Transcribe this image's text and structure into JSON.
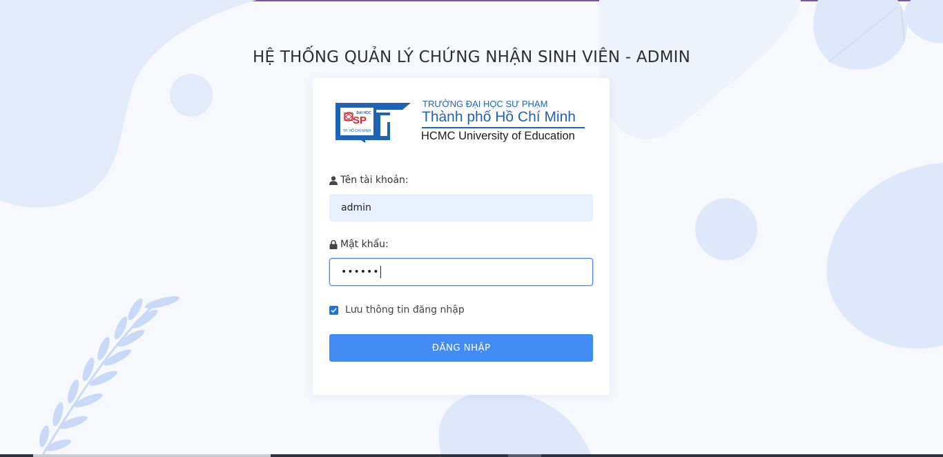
{
  "page": {
    "title": "HỆ THỐNG QUẢN LÝ CHỨNG NHẬN SINH VIÊN - ADMIN"
  },
  "logo": {
    "emblem_top_text": "ĐẠI HỌC",
    "emblem_main_text": "SP",
    "emblem_bottom_text": "TP. HỒ CHÍ MINH",
    "line1": "TRƯỜNG ĐẠI HỌC SƯ PHẠM",
    "line2": "Thành phố Hồ Chí Minh",
    "line3": "HCMC University of Education"
  },
  "form": {
    "username_label": "Tên tài khoản:",
    "username_value": "admin",
    "password_label": "Mật khẩu:",
    "password_masked": "••••••",
    "remember_label": "Lưu thông tin đăng nhập",
    "remember_checked": true,
    "submit_label": "ĐĂNG NHẬP"
  },
  "icons": {
    "username": "user-icon",
    "password": "lock-icon",
    "remember": "check-icon"
  },
  "colors": {
    "accent": "#428bf2",
    "logo_blue": "#1e63b5",
    "input_fill": "#e8effd",
    "background": "#f6f8fc",
    "decor": "#dfe8fb",
    "top_border": "#7b52a8"
  }
}
